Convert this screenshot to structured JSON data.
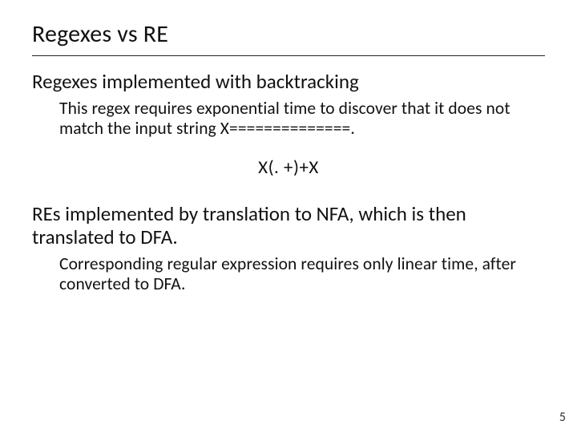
{
  "title": "Regexes vs RE",
  "section1": {
    "heading": "Regexes implemented with backtracking",
    "body": "This regex requires exponential time to discover that it does not match the input string X==============."
  },
  "regex_example": "X(. +)+X",
  "section2": {
    "heading": "REs implemented by translation to NFA, which is then translated to DFA.",
    "body": "Corresponding regular expression requires only linear time, after converted to DFA."
  },
  "page_number": "5"
}
